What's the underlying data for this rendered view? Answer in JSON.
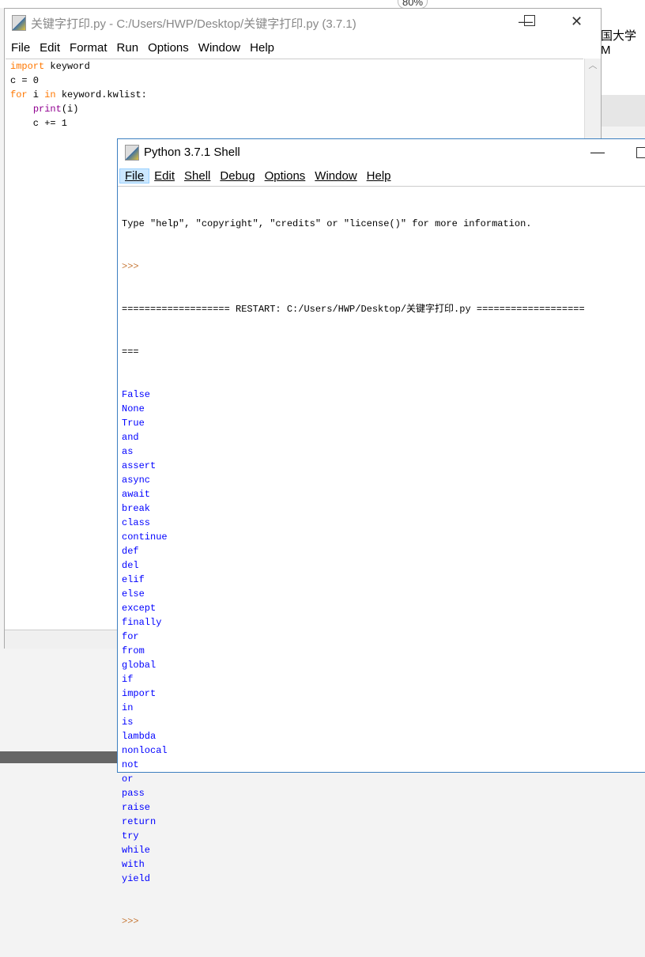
{
  "browser": {
    "zoom": "80%",
    "tab_fragment": "国大学M"
  },
  "editor": {
    "title": "关键字打印.py - C:/Users/HWP/Desktop/关键字打印.py (3.7.1)",
    "menu": [
      "File",
      "Edit",
      "Format",
      "Run",
      "Options",
      "Window",
      "Help"
    ],
    "code": [
      [
        {
          "t": "import",
          "c": "kw"
        },
        {
          "t": " keyword",
          "c": ""
        }
      ],
      [
        {
          "t": "c = 0",
          "c": ""
        }
      ],
      [
        {
          "t": "for",
          "c": "kw"
        },
        {
          "t": " i ",
          "c": ""
        },
        {
          "t": "in",
          "c": "kw"
        },
        {
          "t": " keyword.kwlist:",
          "c": ""
        }
      ],
      [
        {
          "t": "    ",
          "c": ""
        },
        {
          "t": "print",
          "c": "bi"
        },
        {
          "t": "(i)",
          "c": ""
        }
      ],
      [
        {
          "t": "    c += 1",
          "c": ""
        }
      ]
    ]
  },
  "shell": {
    "title": "Python 3.7.1 Shell",
    "menu": [
      "File",
      "Edit",
      "Shell",
      "Debug",
      "Options",
      "Window",
      "Help"
    ],
    "info": "Type \"help\", \"copyright\", \"credits\" or \"license()\" for more information.",
    "prompt": ">>>",
    "restart": "=================== RESTART: C:/Users/HWP/Desktop/关键字打印.py ===================",
    "restart_cont": "===",
    "output": [
      "False",
      "None",
      "True",
      "and",
      "as",
      "assert",
      "async",
      "await",
      "break",
      "class",
      "continue",
      "def",
      "del",
      "elif",
      "else",
      "except",
      "finally",
      "for",
      "from",
      "global",
      "if",
      "import",
      "in",
      "is",
      "lambda",
      "nonlocal",
      "not",
      "or",
      "pass",
      "raise",
      "return",
      "try",
      "while",
      "with",
      "yield"
    ]
  },
  "colors": {
    "keyword": "#ff7700",
    "builtin": "#900090",
    "output": "#0000ff",
    "prompt": "#c77a3a"
  }
}
